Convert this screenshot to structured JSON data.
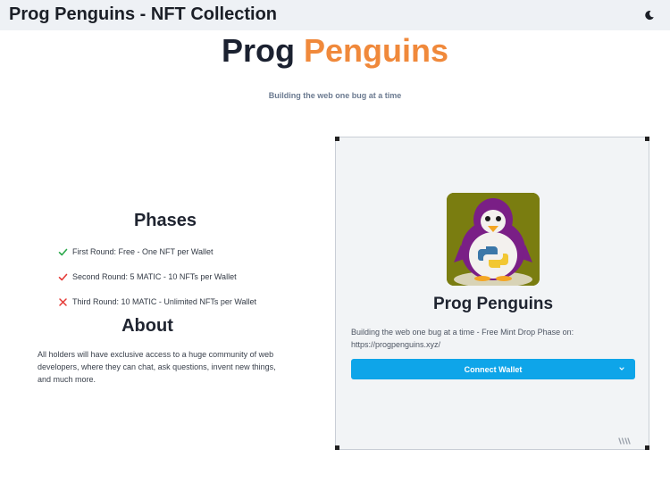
{
  "header": {
    "title": "Prog Penguins - NFT Collection",
    "theme_icon": "moon-icon"
  },
  "hero": {
    "title_part1": "Prog",
    "title_part2": "Penguins",
    "subtitle": "Building the web one bug at a time",
    "accent_color": "#f0893b"
  },
  "phases": {
    "title": "Phases",
    "items": [
      {
        "label": "First Round: Free - One NFT per Wallet",
        "status": "check",
        "color": "#2aa84a"
      },
      {
        "label": "Second Round: 5 MATIC - 10 NFTs per Wallet",
        "status": "check",
        "color": "#e53935"
      },
      {
        "label": "Third Round: 10 MATIC - Unlimited NFTs per Wallet",
        "status": "cross",
        "color": "#e53935"
      }
    ]
  },
  "about": {
    "title": "About",
    "text": "All holders will have exclusive access to a huge community of web developers, where they can chat, ask questions, invent new things, and much more."
  },
  "card": {
    "title": "Prog Penguins",
    "description": "Building the web one bug at a time - Free Mint Drop Phase on: https://progpenguins.xyz/",
    "button_label": "Connect Wallet",
    "button_color": "#0ea5e9",
    "logo_icon": "penguin-python-logo",
    "brand_icon": "thirdweb-icon"
  }
}
